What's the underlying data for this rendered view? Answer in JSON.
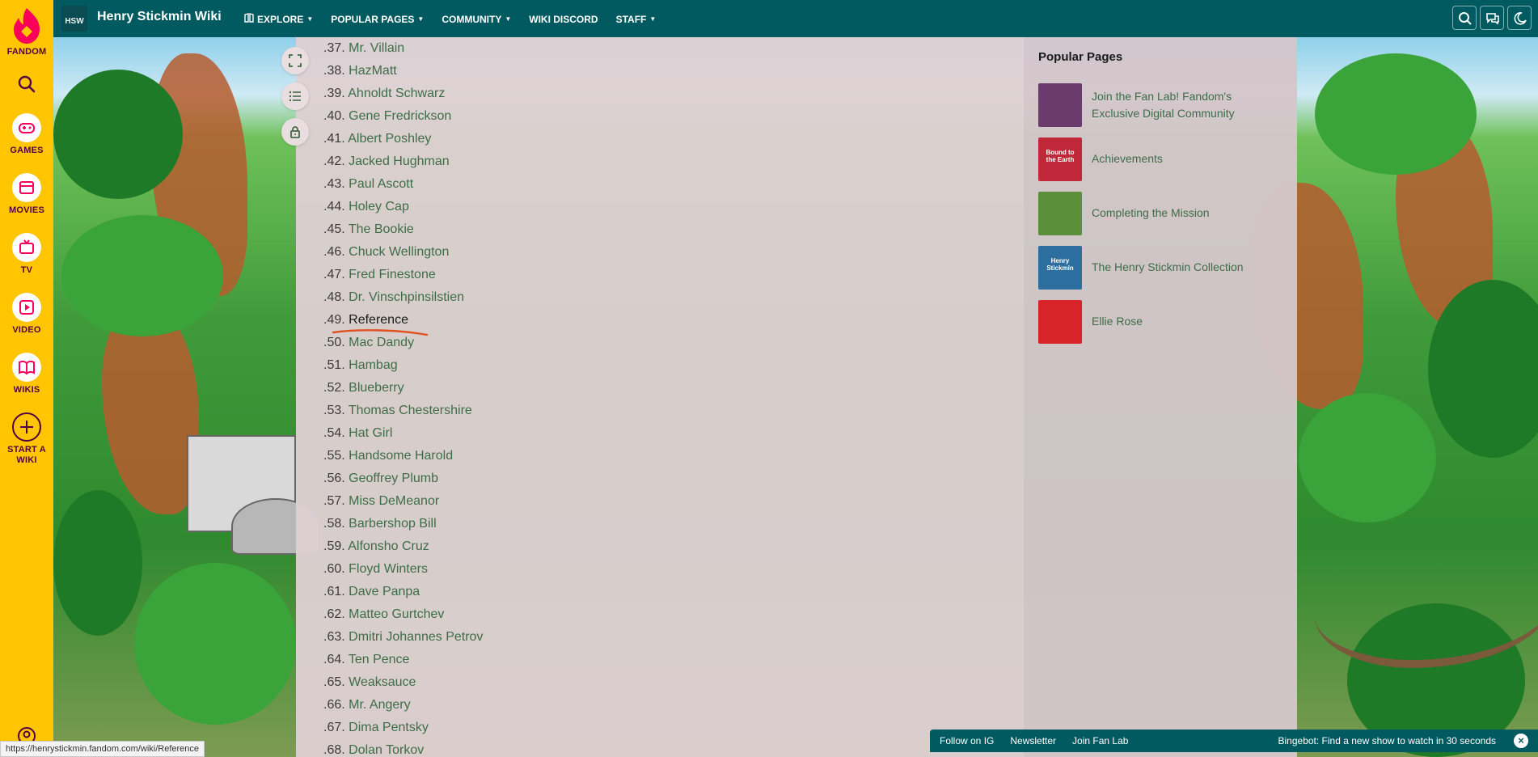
{
  "rail": {
    "brand": "FANDOM",
    "items": [
      {
        "label": "GAMES",
        "icon": "gamepad-icon"
      },
      {
        "label": "MOVIES",
        "icon": "movie-icon"
      },
      {
        "label": "TV",
        "icon": "tv-icon"
      },
      {
        "label": "VIDEO",
        "icon": "video-icon"
      },
      {
        "label": "WIKIS",
        "icon": "book-icon"
      },
      {
        "label": "START A WIKI",
        "icon": "plus-icon"
      }
    ],
    "colors": {
      "background": "#ffc500",
      "accent": "#fa005a",
      "text": "#520044"
    }
  },
  "topbar": {
    "logo_text": "HSW",
    "title": "Henry Stickmin Wiki",
    "nav": [
      {
        "label": "EXPLORE",
        "dropdown": true
      },
      {
        "label": "POPULAR PAGES",
        "dropdown": true
      },
      {
        "label": "COMMUNITY",
        "dropdown": true
      },
      {
        "label": "WIKI DISCORD",
        "dropdown": false
      },
      {
        "label": "STAFF",
        "dropdown": true
      }
    ],
    "icons": [
      "search-icon",
      "discussions-icon",
      "dark-mode-icon"
    ],
    "color": "#005a60"
  },
  "list_items": [
    {
      "num": ".37.",
      "name": "Mr. Villain"
    },
    {
      "num": ".38.",
      "name": "HazMatt"
    },
    {
      "num": ".39.",
      "name": "Ahnoldt Schwarz"
    },
    {
      "num": ".40.",
      "name": "Gene Fredrickson"
    },
    {
      "num": ".41.",
      "name": "Albert Poshley"
    },
    {
      "num": ".42.",
      "name": "Jacked Hughman"
    },
    {
      "num": ".43.",
      "name": "Paul Ascott"
    },
    {
      "num": ".44.",
      "name": "Holey Cap"
    },
    {
      "num": ".45.",
      "name": "The Bookie"
    },
    {
      "num": ".46.",
      "name": "Chuck Wellington"
    },
    {
      "num": ".47.",
      "name": "Fred Finestone"
    },
    {
      "num": ".48.",
      "name": "Dr. Vinschpinsilstien"
    },
    {
      "num": ".49.",
      "name": "Reference",
      "highlighted": true
    },
    {
      "num": ".50.",
      "name": "Mac Dandy"
    },
    {
      "num": ".51.",
      "name": "Hambag"
    },
    {
      "num": ".52.",
      "name": "Blueberry"
    },
    {
      "num": ".53.",
      "name": "Thomas Chestershire"
    },
    {
      "num": ".54.",
      "name": "Hat Girl"
    },
    {
      "num": ".55.",
      "name": "Handsome Harold"
    },
    {
      "num": ".56.",
      "name": "Geoffrey Plumb"
    },
    {
      "num": ".57.",
      "name": "Miss DeMeanor"
    },
    {
      "num": ".58.",
      "name": "Barbershop Bill"
    },
    {
      "num": ".59.",
      "name": "Alfonsho Cruz"
    },
    {
      "num": ".60.",
      "name": "Floyd Winters"
    },
    {
      "num": ".61.",
      "name": "Dave Panpa"
    },
    {
      "num": ".62.",
      "name": "Matteo Gurtchev"
    },
    {
      "num": ".63.",
      "name": "Dmitri Johannes Petrov"
    },
    {
      "num": ".64.",
      "name": "Ten Pence"
    },
    {
      "num": ".65.",
      "name": "Weaksauce"
    },
    {
      "num": ".66.",
      "name": "Mr. Angery"
    },
    {
      "num": ".67.",
      "name": "Dima Pentsky"
    },
    {
      "num": ".68.",
      "name": "Dolan Torkov"
    }
  ],
  "page_tools": [
    "fullscreen-icon",
    "table-of-contents-icon",
    "lock-icon"
  ],
  "popular_pages": {
    "title": "Popular Pages",
    "items": [
      {
        "label": "Join the Fan Lab! Fandom's Exclusive Digital Community",
        "thumb": "#6b3b6e"
      },
      {
        "label": "Achievements",
        "thumb": "#c0283a",
        "thumb_text": "Bound to the Earth"
      },
      {
        "label": "Completing the Mission",
        "thumb": "#5b8f3a"
      },
      {
        "label": "The Henry Stickmin Collection",
        "thumb": "#2c6e9e",
        "thumb_text": "Henry Stickmin"
      },
      {
        "label": "Ellie Rose",
        "thumb": "#d8232a"
      }
    ]
  },
  "bottombar": {
    "links": [
      "Follow on IG",
      "Newsletter",
      "Join Fan Lab"
    ],
    "bingebot": "Bingebot: Find a new show to watch in 30 seconds"
  },
  "status_url": "https://henrystickmin.fandom.com/wiki/Reference"
}
